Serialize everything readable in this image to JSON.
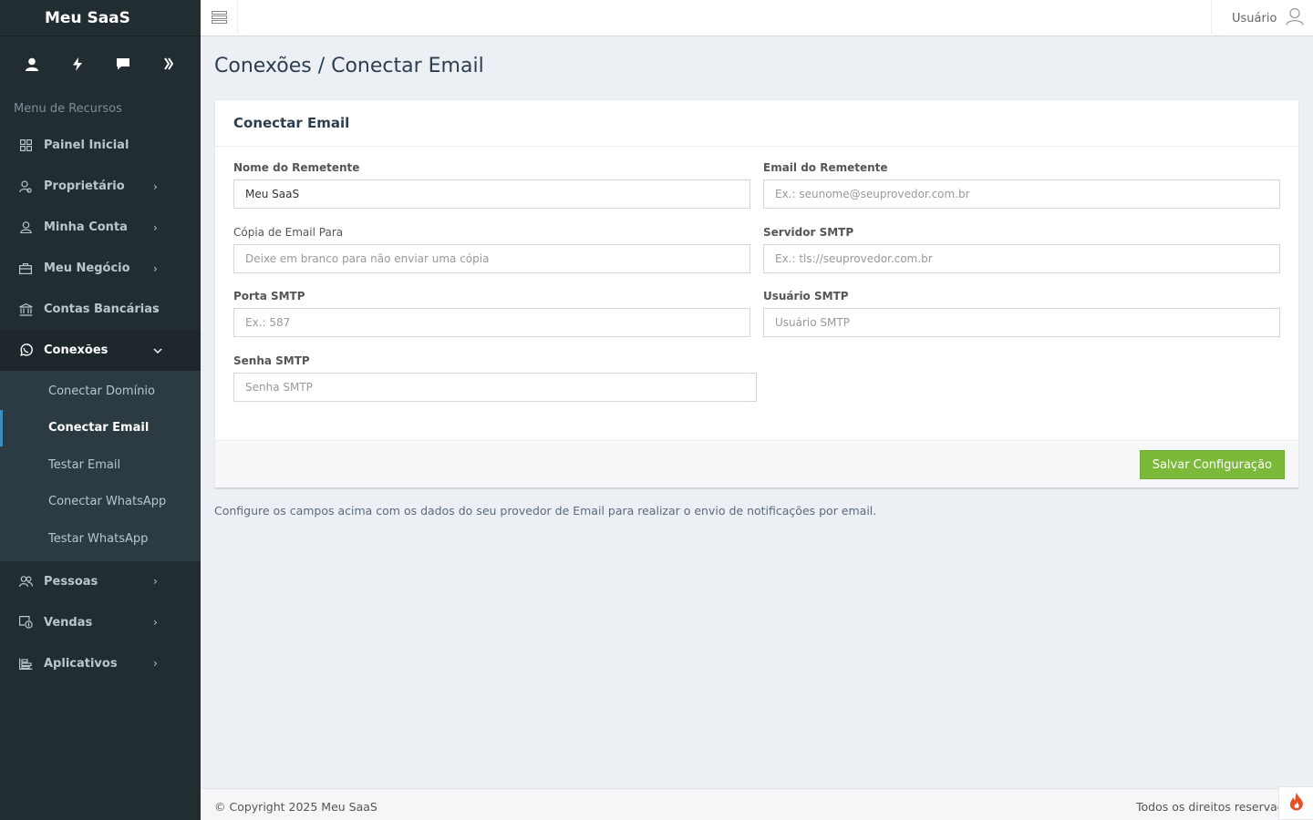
{
  "brand": {
    "name": "Meu SaaS"
  },
  "quick_icons": [
    "user-icon",
    "bolt-icon",
    "chat-icon",
    "double-chevron-right-icon"
  ],
  "sidebar": {
    "header": "Menu de Recursos",
    "items": [
      {
        "label": "Painel Inicial",
        "icon": "grid-icon"
      },
      {
        "label": "Proprietário",
        "icon": "owner-icon"
      },
      {
        "label": "Minha Conta",
        "icon": "user-outline-icon"
      },
      {
        "label": "Meu Negócio",
        "icon": "briefcase-icon"
      },
      {
        "label": "Contas Bancárias",
        "icon": "bank-icon"
      },
      {
        "label": "Conexões",
        "icon": "whatsapp-icon"
      },
      {
        "label": "Pessoas",
        "icon": "people-icon"
      },
      {
        "label": "Vendas",
        "icon": "sales-icon"
      },
      {
        "label": "Aplicativos",
        "icon": "apps-icon"
      }
    ],
    "submenu": [
      {
        "label": "Conectar Domínio"
      },
      {
        "label": "Conectar Email"
      },
      {
        "label": "Testar Email"
      },
      {
        "label": "Conectar WhatsApp"
      },
      {
        "label": "Testar WhatsApp"
      }
    ]
  },
  "topbar": {
    "user_label": "Usuário"
  },
  "page": {
    "title": "Conexões / Conectar Email"
  },
  "form": {
    "title": "Conectar Email",
    "sender_name": {
      "label": "Nome do Remetente",
      "value": "Meu SaaS",
      "placeholder": ""
    },
    "sender_email": {
      "label": "Email do Remetente",
      "value": "",
      "placeholder": "Ex.: seunome@seuprovedor.com.br"
    },
    "copy_to": {
      "label": "Cópia de Email Para",
      "value": "",
      "placeholder": "Deixe em branco para não enviar uma cópia"
    },
    "smtp_server": {
      "label": "Servidor SMTP",
      "value": "",
      "placeholder": "Ex.: tls://seuprovedor.com.br"
    },
    "smtp_port": {
      "label": "Porta SMTP",
      "value": "",
      "placeholder": "Ex.: 587"
    },
    "smtp_user": {
      "label": "Usuário SMTP",
      "value": "",
      "placeholder": "Usuário SMTP"
    },
    "smtp_password": {
      "label": "Senha SMTP",
      "value": "",
      "placeholder": "Senha SMTP"
    },
    "save_label": "Salvar Configuração"
  },
  "help_text": "Configure os campos acima com os dados do seu provedor de Email para realizar o envio de notificações por email.",
  "footer": {
    "copyright": "© Copyright 2025 Meu SaaS",
    "rights": "Todos os direitos reservados"
  },
  "colors": {
    "sidebar": "#222d32",
    "accent": "#3c8dbc",
    "save_button": "#7cb93a"
  }
}
